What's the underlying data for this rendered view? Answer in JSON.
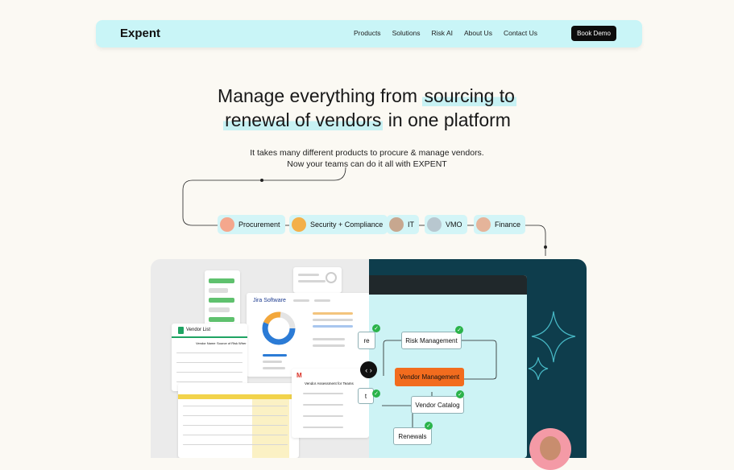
{
  "nav": {
    "brand": "Expent",
    "links": [
      "Products",
      "Solutions",
      "Risk AI",
      "About Us",
      "Contact Us"
    ],
    "cta": "Book Demo"
  },
  "hero": {
    "line1_pre": "Manage everything from ",
    "line1_hl": "sourcing to",
    "line2_hl": "renewal of vendors",
    "line2_post": " in one platform",
    "sub1": "It takes many different products to procure & manage vendors.",
    "sub2": "Now your teams can do it all with EXPENT"
  },
  "teams": [
    "Procurement",
    "Security + Compliance",
    "IT",
    "VMO",
    "Finance"
  ],
  "preview_left": {
    "jira": "Jira Software",
    "vendor_list": "Vendor List",
    "col1": "Vendor Name",
    "col2": "Source of Risk",
    "col3": "Wher",
    "email_title": "Vendor Assessment for Teams"
  },
  "preview_right": {
    "risk": "Risk Management",
    "vm": "Vendor Management",
    "catalog": "Vendor Catalog",
    "renewals": "Renewals",
    "partial1": "re",
    "partial2": "t"
  },
  "colors": {
    "accent": "#c9f5f7",
    "highlight": "#f26c1e",
    "panel_dark": "#0e3d4c"
  }
}
